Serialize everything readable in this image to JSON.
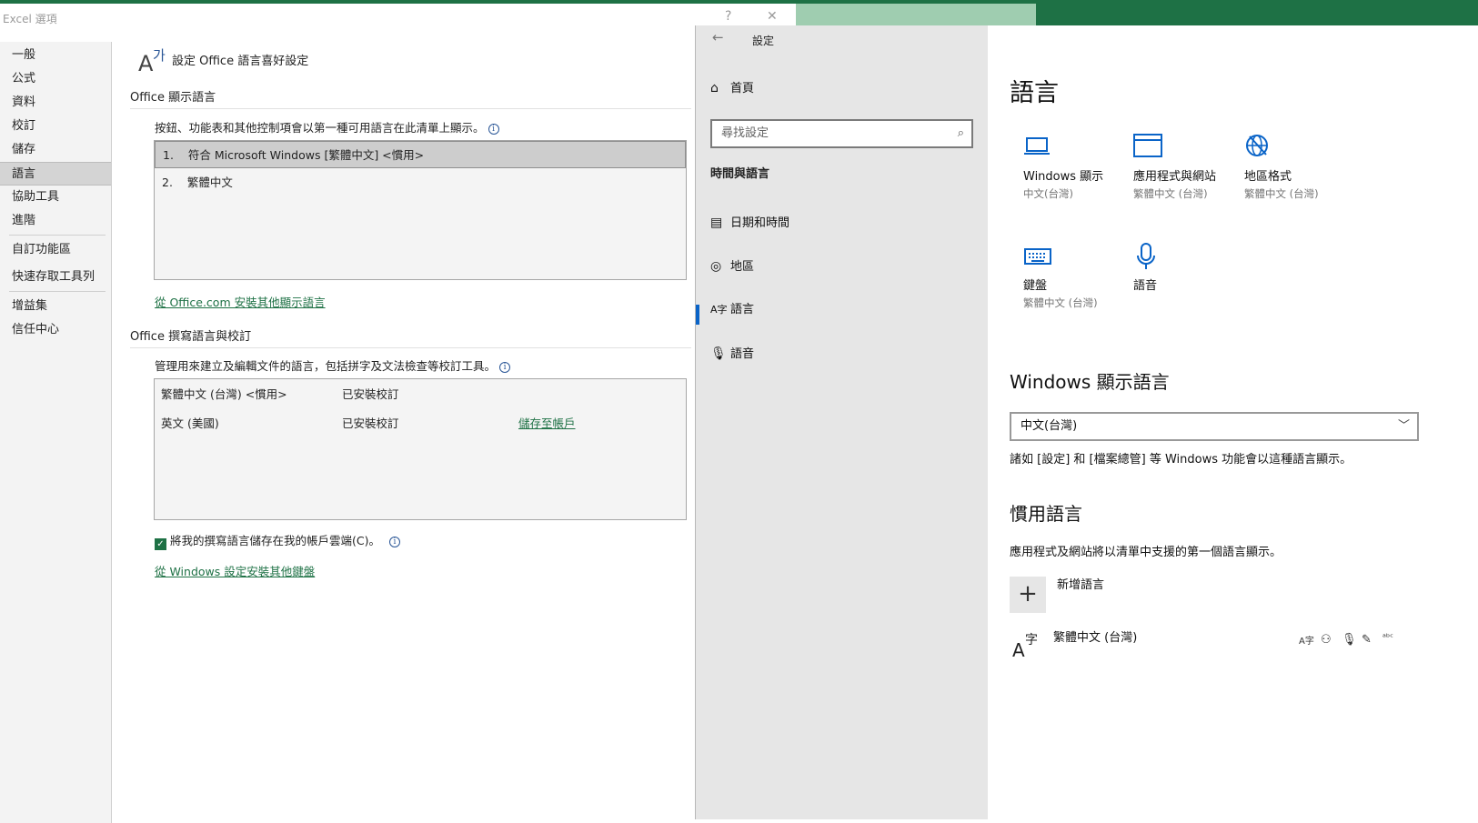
{
  "excel": {
    "title": "Excel 選項",
    "help": "?",
    "close": "✕",
    "nav": [
      "一般",
      "公式",
      "資料",
      "校訂",
      "儲存",
      "語言",
      "協助工具",
      "進階",
      "自訂功能區",
      "快速存取工具列",
      "增益集",
      "信任中心"
    ],
    "nav_selected": "語言",
    "page_heading": "設定 Office 語言喜好設定",
    "display_section": {
      "title": "Office 顯示語言",
      "description": "按鈕、功能表和其他控制項會以第一種可用語言在此清單上顯示。",
      "items": [
        {
          "num": "1.",
          "label": "符合 Microsoft Windows [繁體中文] <慣用>"
        },
        {
          "num": "2.",
          "label": "繁體中文"
        }
      ],
      "link": "從 Office.com 安裝其他顯示語言"
    },
    "authoring_section": {
      "title": "Office 撰寫語言與校訂",
      "description": "管理用來建立及編輯文件的語言，包括拼字及文法檢查等校訂工具。",
      "rows": [
        {
          "language": "繁體中文 (台灣) <慣用>",
          "status": "已安裝校訂",
          "action": ""
        },
        {
          "language": "英文 (美國)",
          "status": "已安裝校訂",
          "action": "儲存至帳戶"
        }
      ],
      "checkbox_label": "將我的撰寫語言儲存在我的帳戶雲端(C)。",
      "checkbox_checked": true,
      "link": "從 Windows 設定安裝其他鍵盤"
    }
  },
  "settings": {
    "back": "←",
    "title": "設定",
    "home": "首頁",
    "search_placeholder": "尋找設定",
    "group": "時間與語言",
    "nav": [
      {
        "icon": "calendar-clock-icon",
        "glyph": "🗓",
        "label": "日期和時間"
      },
      {
        "icon": "globe-region-icon",
        "glyph": "◎",
        "label": "地區"
      },
      {
        "icon": "language-icon",
        "glyph": "A字",
        "label": "語言"
      },
      {
        "icon": "microphone-icon",
        "glyph": "🎙",
        "label": "語音"
      }
    ],
    "selected_nav": "語言",
    "heading": "語言",
    "tiles": [
      {
        "icon": "laptop-icon",
        "name": "Windows 顯示",
        "sub": "中文(台灣)"
      },
      {
        "icon": "window-icon",
        "name": "應用程式與網站",
        "sub": "繁體中文 (台灣)"
      },
      {
        "icon": "region-format-icon",
        "name": "地區格式",
        "sub": "繁體中文 (台灣)"
      },
      {
        "icon": "keyboard-icon",
        "name": "鍵盤",
        "sub": "繁體中文 (台灣)"
      },
      {
        "icon": "microphone-icon",
        "name": "語音",
        "sub": ""
      }
    ],
    "display_language": {
      "title": "Windows 顯示語言",
      "value": "中文(台灣)",
      "note": "諸如 [設定] 和 [檔案總管] 等 Windows 功能會以這種語言顯示。"
    },
    "preferred": {
      "title": "慣用語言",
      "note": "應用程式及網站將以清單中支援的第一個語言顯示。",
      "add_label": "新增語言",
      "language": "繁體中文 (台灣)"
    },
    "colors": {
      "accent": "#0a64c8",
      "excel_green": "#1e7145"
    }
  }
}
